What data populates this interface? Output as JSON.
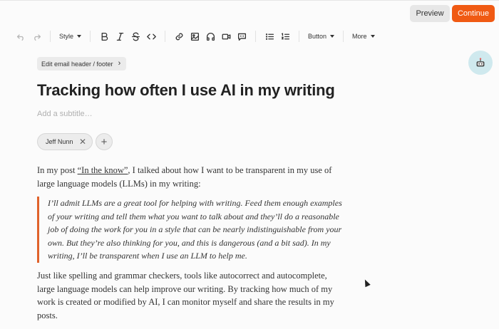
{
  "header": {
    "preview_label": "Preview",
    "continue_label": "Continue"
  },
  "toolbar": {
    "style_label": "Style",
    "button_label": "Button",
    "more_label": "More",
    "icons": [
      "undo-icon",
      "redo-icon",
      "bold-icon",
      "italic-icon",
      "strikethrough-icon",
      "code-icon",
      "link-icon",
      "image-icon",
      "audio-icon",
      "video-icon",
      "comment-icon",
      "bulleted-list-icon",
      "numbered-list-icon"
    ]
  },
  "editor": {
    "edit_header_label": "Edit email header / footer",
    "title": "Tracking how often I use AI in my writing",
    "subtitle_placeholder": "Add a subtitle…",
    "author": "Jeff Nunn",
    "p1_before": "In my post ",
    "p1_link": "“In the know”",
    "p1_after": ", I talked about how I want to be transparent in my use of large language models (LLMs) in my writing:",
    "quote": "I’ll admit LLMs are a great tool for helping with writing. Feed them enough examples of your writing and tell them what you want to talk about and they’ll do a reasonable job of doing the work for you in a style that can be nearly indistinguishable from your own. But they’re also thinking for you, and this is dangerous (and a bit sad). In my writing, I’ll be transparent when I use an LLM to help me.",
    "p2": "Just like spelling and grammar checkers, tools like autocorrect and autocomplete, large language models can help improve our writing. By tracking how much of my work is created or modified by AI, I can monitor myself and share the results in my posts."
  },
  "colors": {
    "accent": "#f05a13",
    "quote_bar": "#e0622b",
    "assistant_bg": "#cfe9ee"
  }
}
